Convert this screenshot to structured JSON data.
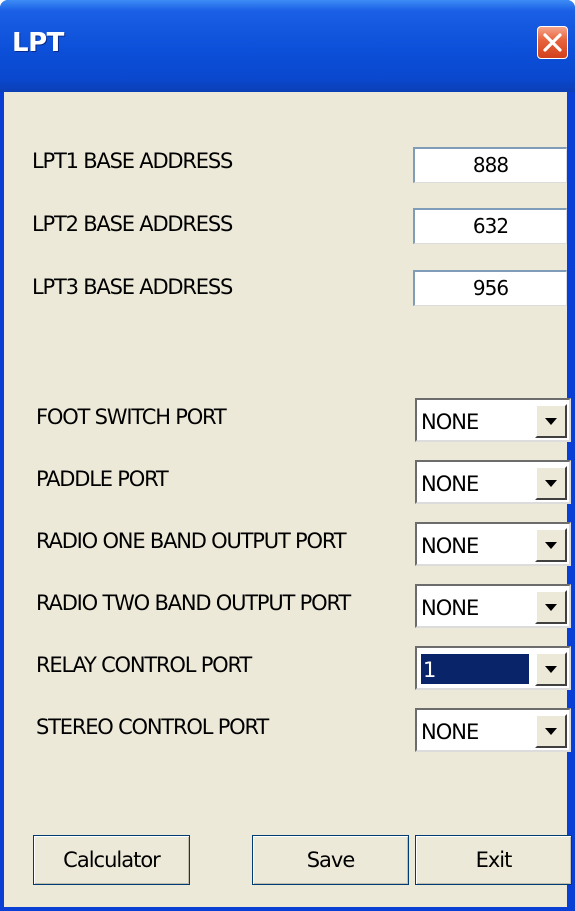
{
  "window": {
    "title": "LPT",
    "close_icon": "close-icon"
  },
  "addresses": [
    {
      "label": "LPT1 BASE ADDRESS",
      "value": "888"
    },
    {
      "label": "LPT2 BASE ADDRESS",
      "value": "632"
    },
    {
      "label": "LPT3 BASE ADDRESS",
      "value": "956"
    }
  ],
  "ports": [
    {
      "label": "FOOT SWITCH PORT",
      "value": "NONE",
      "selected": false
    },
    {
      "label": "PADDLE PORT",
      "value": "NONE",
      "selected": false
    },
    {
      "label": "RADIO ONE BAND OUTPUT PORT",
      "value": "NONE",
      "selected": false
    },
    {
      "label": "RADIO TWO BAND OUTPUT PORT",
      "value": "NONE",
      "selected": false
    },
    {
      "label": "RELAY CONTROL PORT",
      "value": "1",
      "selected": true
    },
    {
      "label": "STEREO CONTROL PORT",
      "value": "NONE",
      "selected": false
    }
  ],
  "buttons": {
    "calculator": "Calculator",
    "save": "Save",
    "exit": "Exit"
  },
  "colors": {
    "titlebar": "#0c4fd8",
    "dialog_bg": "#ece9d8",
    "selection": "#0a246a",
    "close_button": "#e8653f"
  }
}
